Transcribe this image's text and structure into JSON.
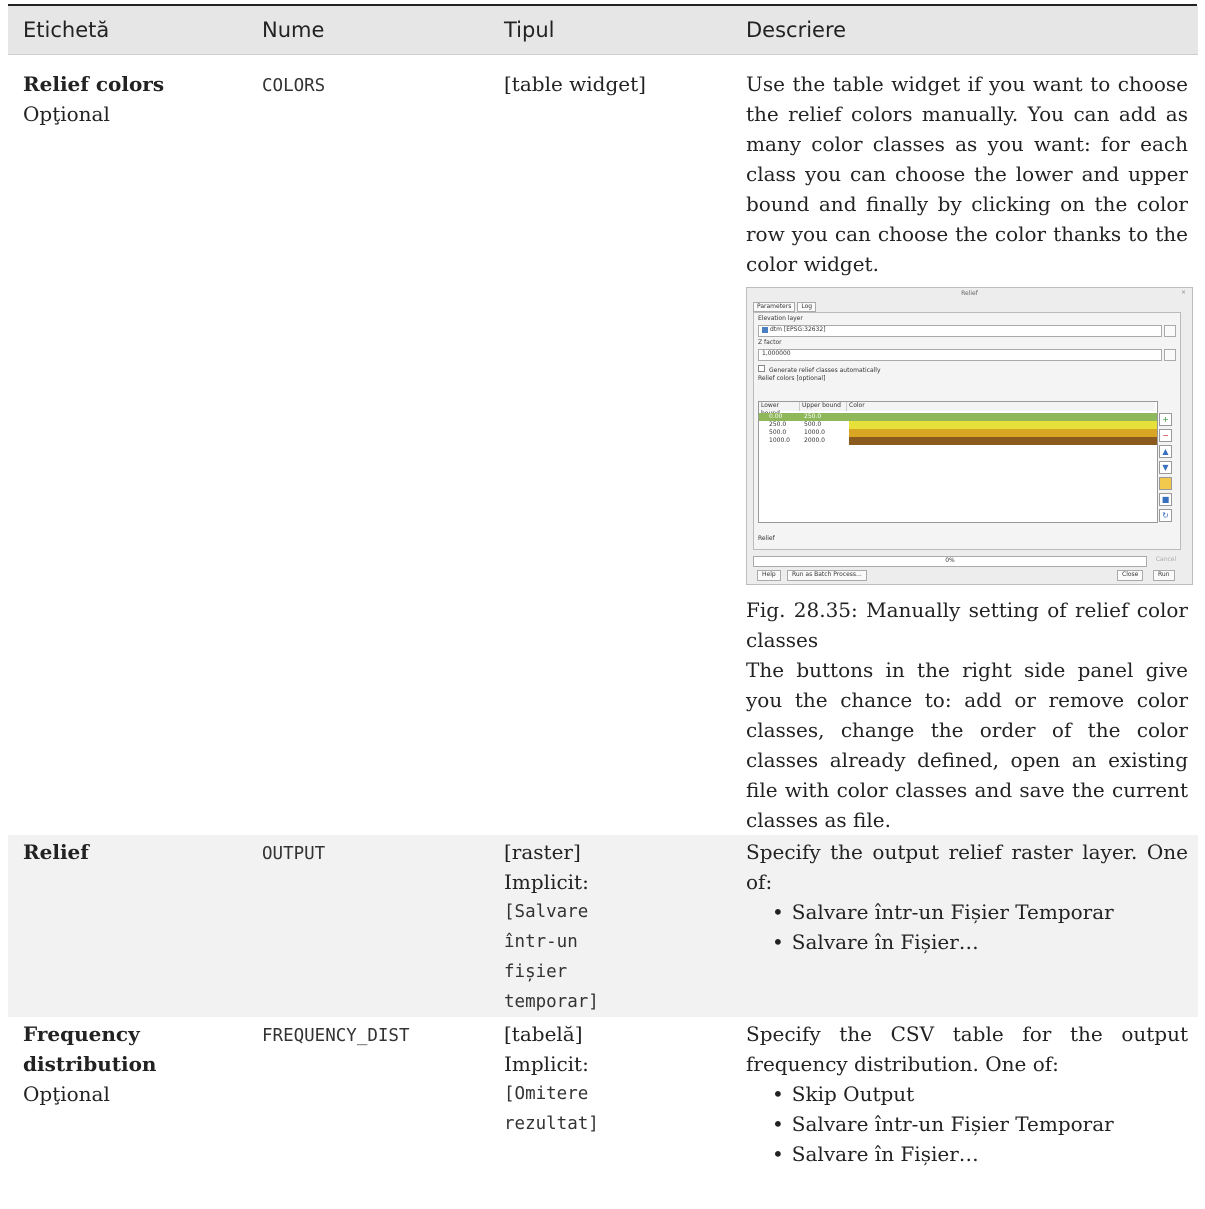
{
  "header": {
    "col1": "Etichetă",
    "col2": "Nume",
    "col3": "Tipul",
    "col4": "Descriere"
  },
  "rows": [
    {
      "label": "Relief colors",
      "optional": "Opţional",
      "name": "COLORS",
      "type": "[table widget]",
      "description": "Use the table widget if you want to choose the relief colors manually. You can add as many color classes as you want: for each class you can choose the lower and upper bound and finally by clicking on the color row you can choose the color thanks to the color widget.",
      "figure": {
        "title": "Relief",
        "close": "×",
        "tab_parameters": "Parameters",
        "tab_log": "Log",
        "elevation_layer_label": "Elevation layer",
        "elevation_layer_value": "dtm [EPSG:32632]",
        "z_factor_label": "Z factor",
        "z_factor_value": "1,000000",
        "auto_classes_label": "Generate relief classes automatically",
        "relief_colors_label": "Relief colors [optional]",
        "table_headers": [
          "Lower bound",
          "Upper bound",
          "Color"
        ],
        "table_rows": [
          {
            "lower": "0.00",
            "upper": "250.0",
            "color": "#8fb85a"
          },
          {
            "lower": "250.0",
            "upper": "500.0",
            "color": "#e6e03a"
          },
          {
            "lower": "500.0",
            "upper": "1000.0",
            "color": "#d9a623"
          },
          {
            "lower": "1000.0",
            "upper": "2000.0",
            "color": "#8a5a1f"
          }
        ],
        "relief_output_label": "Relief",
        "progress": "0%",
        "cancel": "Cancel",
        "help": "Help",
        "batch": "Run as Batch Process...",
        "close_btn": "Close",
        "run": "Run",
        "tool_icons": [
          "add-icon",
          "remove-icon",
          "move-up-icon",
          "move-down-icon",
          "open-folder-icon",
          "save-icon",
          "refresh-icon"
        ]
      },
      "caption": "Fig. 28.35: Manually setting of relief color classes",
      "description2": "The buttons in the right side panel give you the chance to: add or remove color classes, change the order of the color classes already defined, open an existing file with color classes and save the current classes as file."
    },
    {
      "label": "Relief",
      "name": "OUTPUT",
      "type": "[raster]",
      "default_label": "Implicit:",
      "default_lines": [
        "[Salvare",
        "într-un",
        "fișier",
        "temporar]"
      ],
      "description": "Specify the output relief raster layer. One of:",
      "options": [
        "Salvare într-un Fișier Temporar",
        "Salvare în Fișier…"
      ]
    },
    {
      "label_lines": [
        "Frequency",
        "distribution"
      ],
      "optional": "Opţional",
      "name": "FREQUENCY_DIST",
      "type": "[tabelă]",
      "default_label": "Implicit:",
      "default_lines": [
        "[Omitere",
        "rezultat]"
      ],
      "description": "Specify the CSV table for the output frequency distribution. One of:",
      "options": [
        "Skip Output",
        "Salvare într-un Fișier Temporar",
        "Salvare în Fișier…"
      ]
    }
  ]
}
